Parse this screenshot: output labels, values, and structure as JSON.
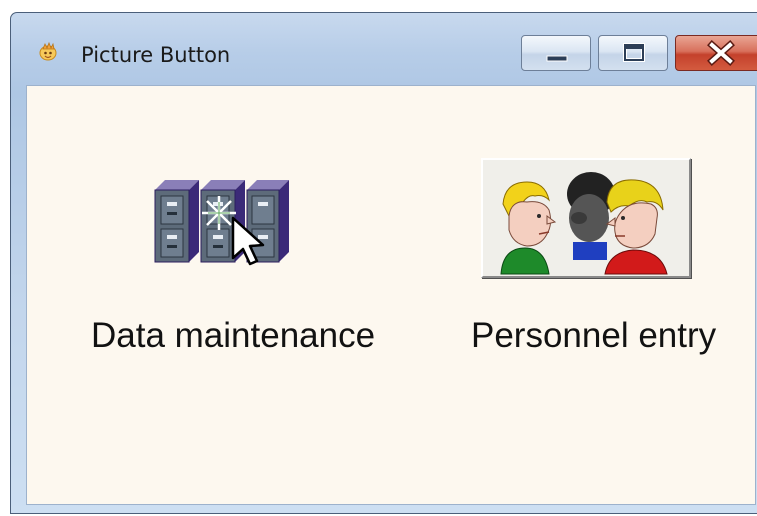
{
  "window": {
    "title": "Picture Button"
  },
  "buttons": [
    {
      "label": "Data maintenance",
      "icon": "file-cabinets-cursor-icon"
    },
    {
      "label": "Personnel entry",
      "icon": "people-faces-icon"
    }
  ],
  "colors": {
    "client_background": "#fdf8ef",
    "close_button": "#c4412c",
    "titlebar": "#b7cde8"
  }
}
